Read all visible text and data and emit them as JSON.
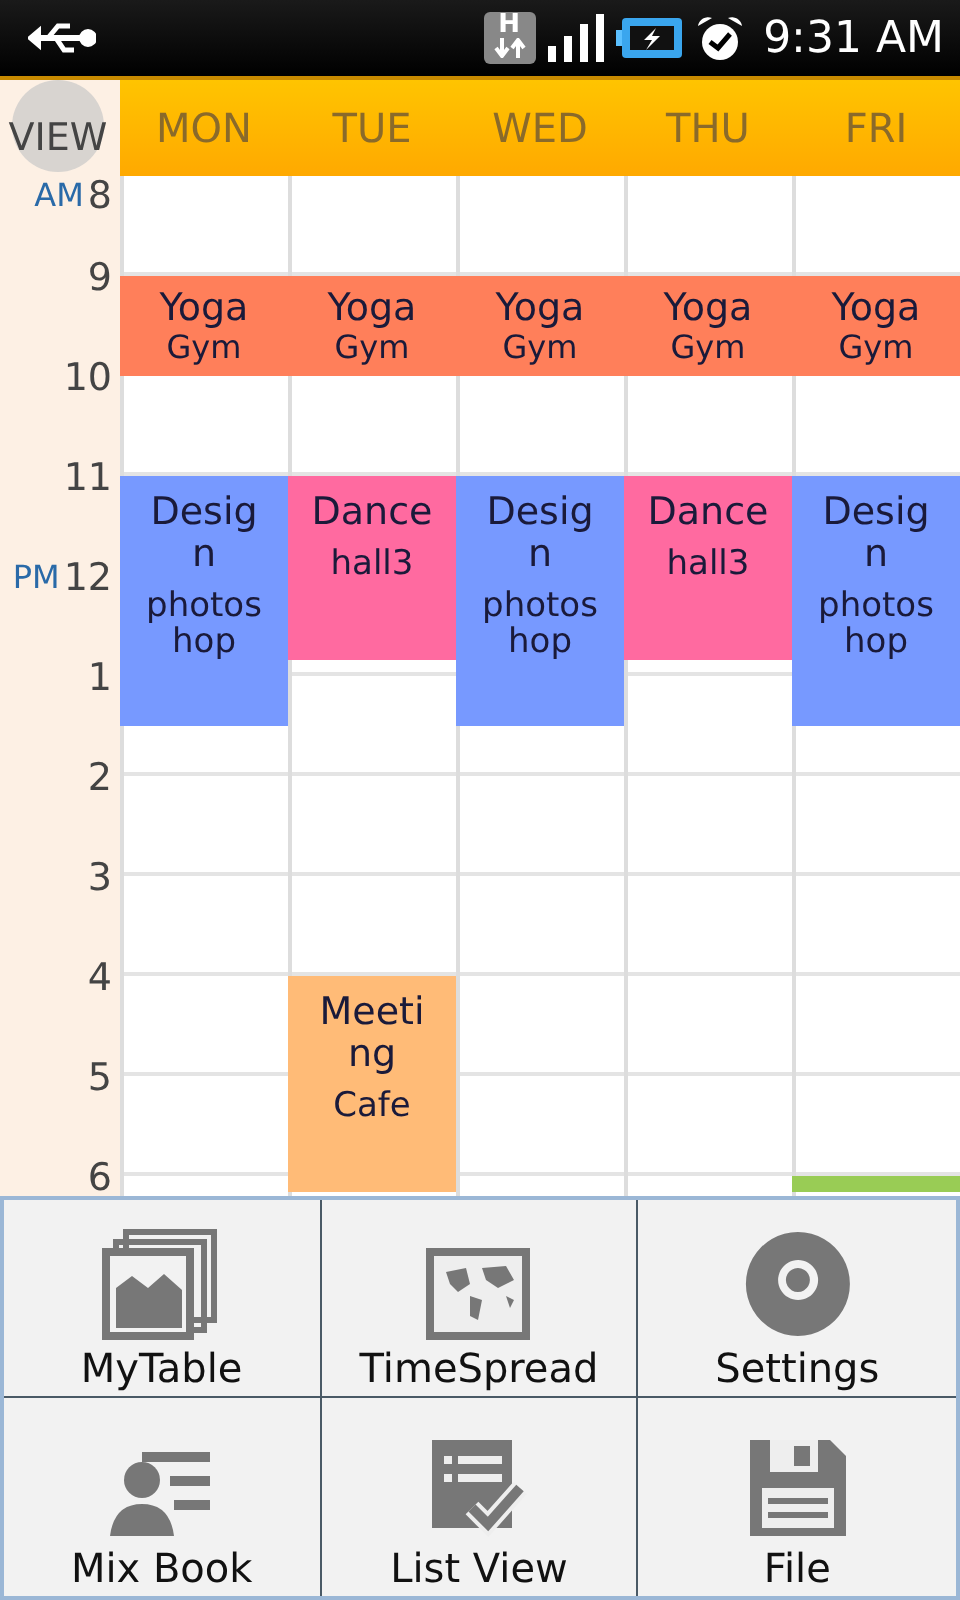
{
  "status_bar": {
    "network_type": "H",
    "time": "9:31 AM"
  },
  "view_button": {
    "label": "VIEW"
  },
  "hours": [
    {
      "label": "8",
      "period": "AM"
    },
    {
      "label": "9"
    },
    {
      "label": "10"
    },
    {
      "label": "11"
    },
    {
      "label": "12",
      "period": "PM"
    },
    {
      "label": "1"
    },
    {
      "label": "2"
    },
    {
      "label": "3"
    },
    {
      "label": "4"
    },
    {
      "label": "5"
    },
    {
      "label": "6"
    }
  ],
  "days": [
    {
      "label": "MON",
      "events": [
        {
          "title": "Yoga",
          "location": "Gym",
          "color": "#ff7f5a"
        },
        {
          "title": "Design",
          "location": "photoshop",
          "color": "#7799ff"
        }
      ]
    },
    {
      "label": "TUE",
      "events": [
        {
          "title": "Yoga",
          "location": "Gym",
          "color": "#ff7f5a"
        },
        {
          "title": "Dance",
          "location": "hall3",
          "color": "#ff6aa0"
        },
        {
          "title": "Meeting",
          "location": "Cafe",
          "color": "#ffbb77"
        }
      ]
    },
    {
      "label": "WED",
      "events": [
        {
          "title": "Yoga",
          "location": "Gym",
          "color": "#ff7f5a"
        },
        {
          "title": "Design",
          "location": "photoshop",
          "color": "#7799ff"
        }
      ]
    },
    {
      "label": "THU",
      "events": [
        {
          "title": "Yoga",
          "location": "Gym",
          "color": "#ff7f5a"
        },
        {
          "title": "Dance",
          "location": "hall3",
          "color": "#ff6aa0"
        }
      ]
    },
    {
      "label": "FRI",
      "events": [
        {
          "title": "Yoga",
          "location": "Gym",
          "color": "#ff7f5a"
        },
        {
          "title": "Design",
          "location": "photoshop",
          "color": "#7799ff"
        },
        {
          "color": "#99cc55"
        }
      ]
    }
  ],
  "menu": [
    {
      "label": "MyTable",
      "kind": "gallery"
    },
    {
      "label": "TimeSpread",
      "kind": "map"
    },
    {
      "label": "Settings",
      "kind": "settings"
    },
    {
      "label": "Mix Book",
      "kind": "contact"
    },
    {
      "label": "List View",
      "kind": "checklist"
    },
    {
      "label": "File",
      "kind": "save"
    }
  ]
}
